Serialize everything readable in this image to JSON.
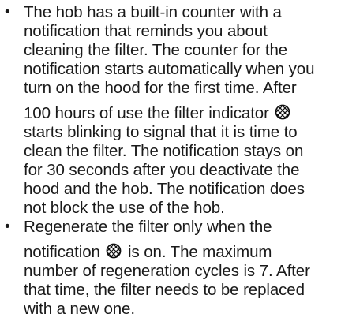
{
  "top_fragment": "",
  "bullet_char": "•",
  "icon": "filter-grid-icon",
  "bullets": [
    {
      "lines": [
        "The hob has a built-in counter with a",
        "notification that reminds you about",
        "cleaning the filter. The counter for the",
        "notification starts automatically when you",
        "turn on the hood for the first time. After",
        "100 hours of use the filter indicator",
        "starts blinking to signal that it is time to",
        "clean the filter. The notification stays on",
        "for 30 seconds after you deactivate the",
        "hood and the hob. The notification does",
        "not block the use of the hob."
      ]
    },
    {
      "lines": [
        "Regenerate the filter only when the",
        "notification",
        "is on. The maximum",
        "number of regeneration cycles is 7. After",
        "that time, the filter needs to be replaced",
        "with a new one."
      ]
    }
  ]
}
